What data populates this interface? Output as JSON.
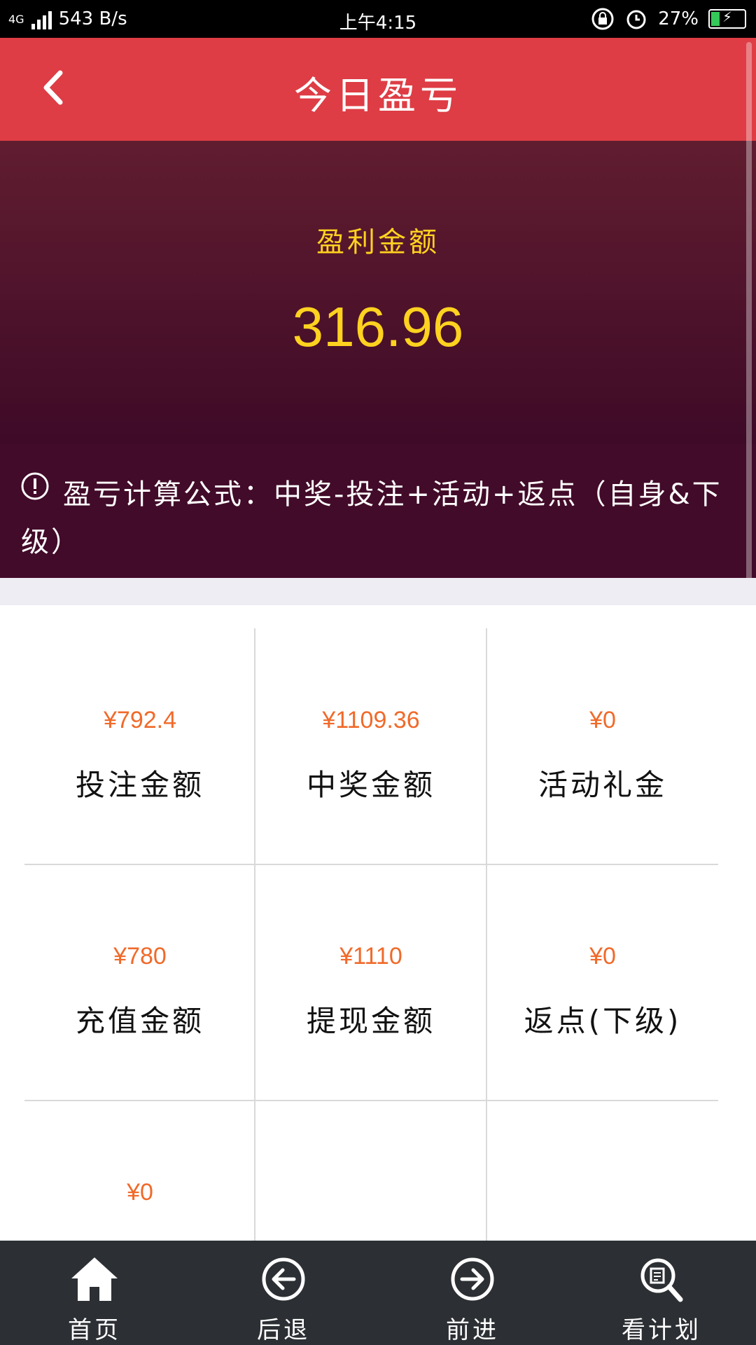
{
  "status_bar": {
    "network": "4G",
    "speed": "543 B/s",
    "time": "上午4:15",
    "battery": "27%",
    "battery_level": 0.27
  },
  "header": {
    "title": "今日盈亏"
  },
  "summary": {
    "label": "盈利金额",
    "value": "316.96"
  },
  "formula": {
    "text": "盈亏计算公式：中奖-投注+活动+返点（自身&下级）"
  },
  "grid": {
    "items": [
      {
        "amount": "¥792.4",
        "label": "投注金额"
      },
      {
        "amount": "¥1109.36",
        "label": "中奖金额"
      },
      {
        "amount": "¥0",
        "label": "活动礼金"
      },
      {
        "amount": "¥780",
        "label": "充值金额"
      },
      {
        "amount": "¥1110",
        "label": "提现金额"
      },
      {
        "amount": "¥0",
        "label": "返点(下级)"
      },
      {
        "amount": "¥0",
        "label": ""
      }
    ]
  },
  "tabbar": {
    "items": [
      {
        "label": "首页",
        "icon": "home-icon"
      },
      {
        "label": "后退",
        "icon": "back-circle-icon"
      },
      {
        "label": "前进",
        "icon": "forward-circle-icon"
      },
      {
        "label": "看计划",
        "icon": "search-document-icon"
      }
    ]
  },
  "colors": {
    "nav": "#de3d45",
    "hero_top": "#611d30",
    "hero_bottom": "#3e0a27",
    "accent_yellow": "#ffd21f",
    "amount_orange": "#f06a2a",
    "tabbar": "#2c2f33"
  }
}
